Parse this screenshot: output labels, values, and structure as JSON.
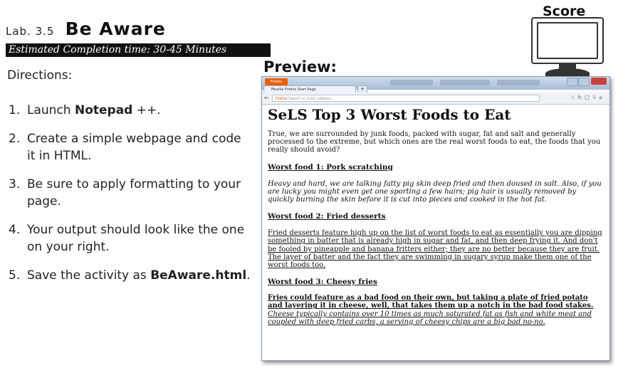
{
  "header": {
    "lab_number": "Lab. 3.5",
    "lab_title": "Be Aware",
    "estimated_time": "Estimated Completion time: 30-45 Minutes"
  },
  "directions": {
    "heading": "Directions:",
    "steps": [
      {
        "num": "1.",
        "before": "Launch ",
        "bold": "Notepad",
        "after": " ++."
      },
      {
        "num": "2.",
        "before": "Create a simple webpage and code it in HTML.",
        "bold": "",
        "after": ""
      },
      {
        "num": "3.",
        "before": "Be sure to apply formatting to your page.",
        "bold": "",
        "after": ""
      },
      {
        "num": "4.",
        "before": "Your output should look like the one on your right.",
        "bold": "",
        "after": ""
      },
      {
        "num": "5.",
        "before": "Save the activity as ",
        "bold": "BeAware.html",
        "after": "."
      }
    ]
  },
  "preview_label": "Preview:",
  "score_label": "Score",
  "browser": {
    "app_button": "Firefox",
    "tab_title": "Mozilla Firefox Start Page",
    "tab_new": "+",
    "url_brand": "Firefox",
    "url_placeholder": "Search or enter address",
    "page": {
      "title": "SeLS Top 3 Worst Foods to Eat",
      "intro": "True, we are surrounded by junk foods, packed with sugar, fat and salt and generally processed to the extreme, but which ones are the real worst foods to eat, the foods that you really should avoid?",
      "heading1": "Worst food 1: Pork scratching",
      "para1": "Heavy and hard, we are talking fatty pig skin deep fried and then doused in salt. Also, if you are lucky you might even get one sporting a few hairs; pig hair is usually removed by quickly burning the skin before it is cut into pieces and cooked in the hot fat.",
      "heading2": "Worst food 2: Fried desserts",
      "para2": "Fried desserts feature high up on the list of worst foods to eat as essentially you are dipping something in batter that is already high in sugar and fat, and then deep frying it. And don't be fooled by pineapple and banana fritters either; they are no better because they are fruit. The layer of batter and the fact they are swimming in sugary syrup make them one of the worst foods too.",
      "heading3": "Worst food 3: Cheesy fries",
      "para3_bold": "Fries could feature as a bad food on their own, but taking a plate of fried potato and layering it in cheese, well, that takes them up a notch in the bad food stakes.",
      "para3_italic": "Cheese typically contains over 10 times as much saturated fat as fish and white meat and coupled with deep fried carbs, a serving of cheesy chips are a big bad no-no."
    }
  }
}
